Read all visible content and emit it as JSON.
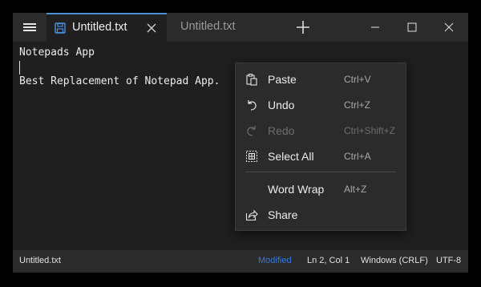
{
  "tabs": {
    "active_label": "Untitled.txt",
    "inactive_label": "Untitled.txt"
  },
  "icons": {
    "menu": "hamburger-icon",
    "file": "save-icon",
    "close_tab": "close-icon",
    "new_tab": "plus-icon",
    "minimize": "minimize-icon",
    "maximize": "maximize-icon",
    "close_window": "close-icon"
  },
  "editor": {
    "lines": [
      "Notepads App",
      "",
      "Best Replacement of Notepad App."
    ]
  },
  "context_menu": {
    "items": [
      {
        "label": "Paste",
        "shortcut": "Ctrl+V",
        "icon": "paste-icon",
        "enabled": true
      },
      {
        "label": "Undo",
        "shortcut": "Ctrl+Z",
        "icon": "undo-icon",
        "enabled": true
      },
      {
        "label": "Redo",
        "shortcut": "Ctrl+Shift+Z",
        "icon": "redo-icon",
        "enabled": false
      },
      {
        "label": "Select All",
        "shortcut": "Ctrl+A",
        "icon": "select-all-icon",
        "enabled": true
      },
      {
        "label": "Word Wrap",
        "shortcut": "Alt+Z",
        "icon": "",
        "enabled": true
      },
      {
        "label": "Share",
        "shortcut": "",
        "icon": "share-icon",
        "enabled": true
      }
    ]
  },
  "status": {
    "filename": "Untitled.txt",
    "modified": "Modified",
    "position": "Ln 2, Col 1",
    "line_ending": "Windows (CRLF)",
    "encoding": "UTF-8"
  },
  "colors": {
    "accent": "#4a90d9",
    "modified": "#3b78d8",
    "background": "#1f1f1f",
    "chrome": "#2b2b2b"
  }
}
